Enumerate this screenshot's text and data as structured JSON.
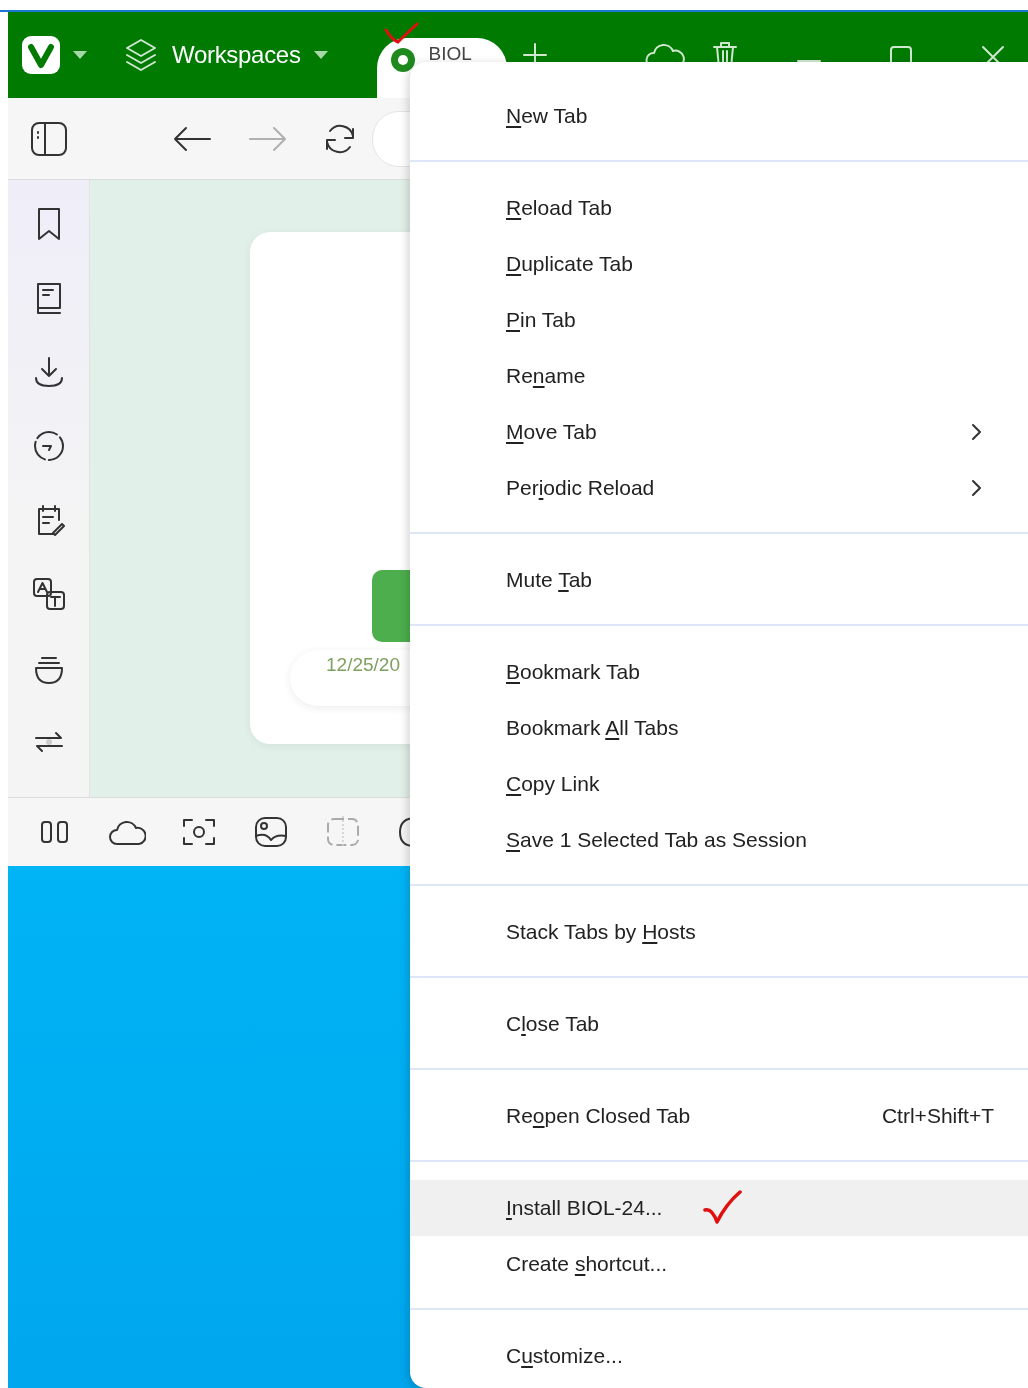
{
  "title_bar": {
    "workspaces_label": "Workspaces",
    "tab": {
      "title": "BIOL"
    }
  },
  "toolbar": {
    "buttons": [
      {
        "kind": "back",
        "disabled": false
      },
      {
        "kind": "forward",
        "disabled": true
      },
      {
        "kind": "reload",
        "disabled": false
      }
    ]
  },
  "page": {
    "date": "12/25/20"
  },
  "menu": {
    "groups": [
      {
        "items": [
          {
            "key": "N",
            "after": "ew Tab",
            "submenu": false,
            "highlighted": false
          }
        ]
      },
      {
        "items": [
          {
            "key": "R",
            "after": "eload Tab",
            "submenu": false,
            "highlighted": false
          },
          {
            "key": "D",
            "after": "uplicate Tab",
            "submenu": false,
            "highlighted": false
          },
          {
            "key": "P",
            "after": "in Tab",
            "submenu": false,
            "highlighted": false
          },
          {
            "before": "Re",
            "key": "n",
            "after": "ame",
            "submenu": false,
            "highlighted": false
          },
          {
            "key": "M",
            "after": "ove Tab",
            "submenu": true,
            "highlighted": false
          },
          {
            "before": "Per",
            "key": "i",
            "after": "odic Reload",
            "submenu": true,
            "highlighted": false
          }
        ]
      },
      {
        "items": [
          {
            "before": "Mute ",
            "key": "T",
            "after": "ab",
            "submenu": false,
            "highlighted": false
          }
        ]
      },
      {
        "items": [
          {
            "key": "B",
            "after": "ookmark Tab",
            "submenu": false,
            "highlighted": false
          },
          {
            "before": "Bookmark ",
            "key": "A",
            "after": "ll Tabs",
            "submenu": false,
            "highlighted": false
          },
          {
            "key": "C",
            "after": "opy Link",
            "submenu": false,
            "highlighted": false
          },
          {
            "key": "S",
            "after": "ave 1 Selected Tab as Session",
            "submenu": false,
            "highlighted": false
          }
        ]
      },
      {
        "items": [
          {
            "before": "Stack Tabs by ",
            "key": "H",
            "after": "osts",
            "submenu": false,
            "highlighted": false
          }
        ]
      },
      {
        "items": [
          {
            "before": "C",
            "key": "l",
            "after": "ose Tab",
            "submenu": false,
            "highlighted": false
          }
        ]
      },
      {
        "items": [
          {
            "before": "Re",
            "key": "o",
            "after": "pen Closed Tab",
            "shortcut": "Ctrl+Shift+T",
            "submenu": false,
            "highlighted": false
          }
        ]
      },
      {
        "items": [
          {
            "key": "I",
            "after": "nstall BIOL-24...",
            "submenu": false,
            "highlighted": true
          },
          {
            "before": "Create ",
            "key": "s",
            "after": "hortcut...",
            "submenu": false,
            "highlighted": false
          }
        ]
      },
      {
        "items": [
          {
            "before": "C",
            "key": "u",
            "after": "stomize...",
            "submenu": false,
            "highlighted": false
          }
        ]
      }
    ]
  }
}
